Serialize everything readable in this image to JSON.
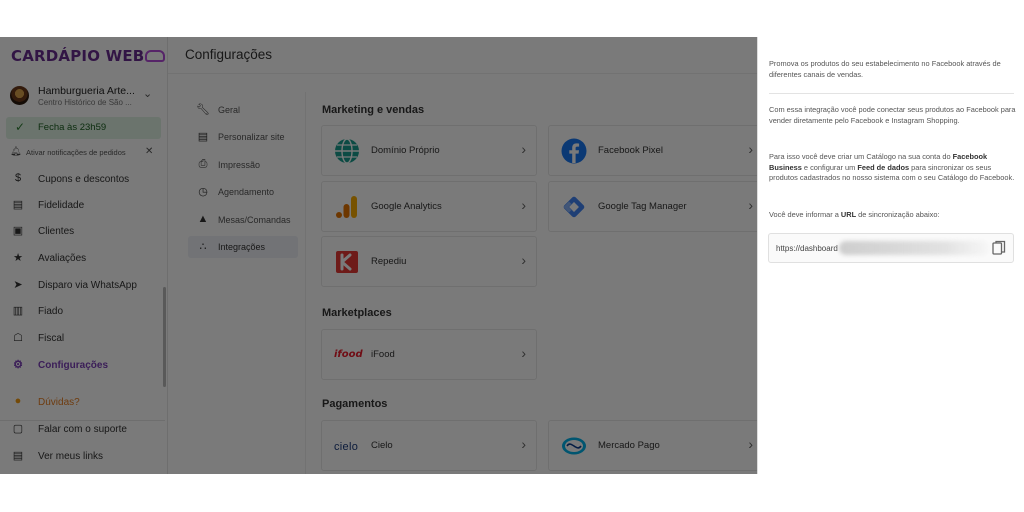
{
  "sidebar": {
    "brand": "CARDÁPIO WEB",
    "store_name": "Hamburgueria Arte...",
    "store_address": "Centro Histórico de São ...",
    "open_status": "Fecha às 23h59",
    "notifications_text": "Ativar notificações de pedidos",
    "items": [
      {
        "label": "Cupons e descontos",
        "icon": "dollar-icon"
      },
      {
        "label": "Fidelidade",
        "icon": "gift-icon"
      },
      {
        "label": "Clientes",
        "icon": "contacts-icon"
      },
      {
        "label": "Avaliações",
        "icon": "star-icon"
      },
      {
        "label": "Disparo via WhatsApp",
        "icon": "send-icon"
      },
      {
        "label": "Fiado",
        "icon": "book-icon"
      },
      {
        "label": "Fiscal",
        "icon": "bank-icon"
      },
      {
        "label": "Configurações",
        "icon": "gear-icon",
        "active": true
      }
    ],
    "bottom_items": [
      {
        "label": "Dúvidas?",
        "icon": "help-icon"
      },
      {
        "label": "Falar com o suporte",
        "icon": "chat-icon"
      },
      {
        "label": "Ver meus links",
        "icon": "links-icon"
      }
    ]
  },
  "header": {
    "title": "Configurações"
  },
  "subnav": {
    "items": [
      {
        "label": "Geral",
        "icon": "wrench-icon"
      },
      {
        "label": "Personalizar site",
        "icon": "web-icon"
      },
      {
        "label": "Impressão",
        "icon": "printer-icon"
      },
      {
        "label": "Agendamento",
        "icon": "clock-icon"
      },
      {
        "label": "Mesas/Comandas",
        "icon": "table-icon"
      },
      {
        "label": "Integrações",
        "icon": "integrations-icon",
        "active": true
      }
    ]
  },
  "integrations": {
    "sections": [
      {
        "title": "Marketing e vendas"
      },
      {
        "title": "Marketplaces"
      },
      {
        "title": "Pagamentos"
      }
    ],
    "cards": [
      {
        "name": "Domínio Próprio"
      },
      {
        "name": "Facebook Pixel"
      },
      {
        "name": "Google Analytics"
      },
      {
        "name": "Google Tag Manager"
      },
      {
        "name": "Repediu"
      },
      {
        "name": "iFood",
        "logo_text": "ifood"
      },
      {
        "name": "Cielo",
        "logo_text": "cielo"
      },
      {
        "name": "Mercado Pago"
      }
    ]
  },
  "panel": {
    "intro": "Promova os produtos do seu estabelecimento no Facebook através de diferentes canais de vendas.",
    "p1": "Com essa integração você pode conectar seus produtos ao Facebook para vender diretamente pelo Facebook e Instagram Shopping.",
    "p2_a": "Para isso você deve criar um Catálogo na sua conta do ",
    "p2_b": "Facebook Business",
    "p2_c": " e configurar um ",
    "p2_d": "Feed de dados",
    "p2_e": " para sincronizar os seus produtos cadastrados no nosso sistema com o seu Catálogo do Facebook.",
    "p3_a": "Você deve informar a ",
    "p3_b": "URL",
    "p3_c": " de sincronização abaixo:",
    "url": "https://dashboard"
  },
  "colors": {
    "brand_purple": "#6a2c91",
    "active_purple": "#7b3fb8",
    "open_green": "#dff3e4",
    "help_orange": "#f39c12"
  }
}
